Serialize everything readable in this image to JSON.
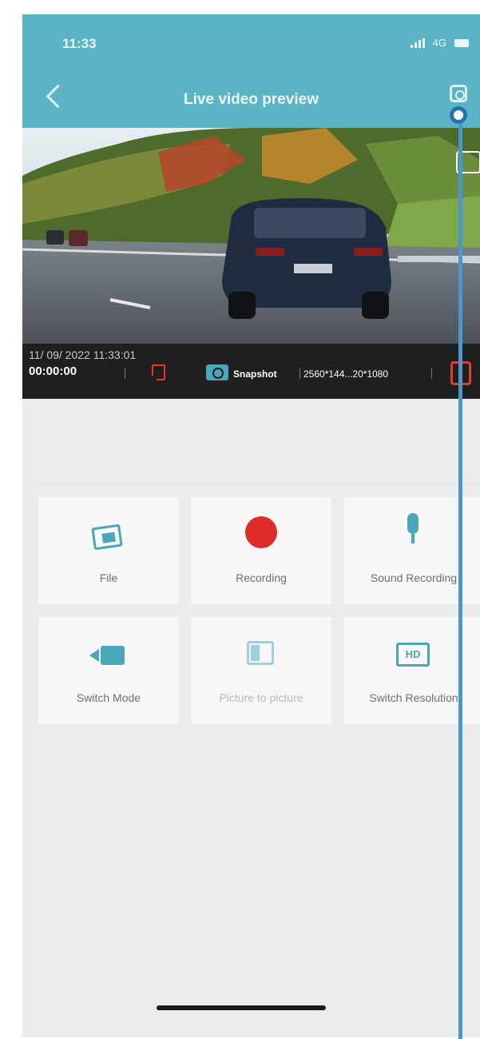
{
  "status_bar": {
    "time": "11:33",
    "network": "4G"
  },
  "header": {
    "title": "Live video preview"
  },
  "info_bar": {
    "datetime": "11/ 09/ 2022  11:33:01",
    "elapsed": "00:00:00",
    "snapshot_label": "Snapshot",
    "resolution": "2560*144...20*1080"
  },
  "tiles": [
    {
      "label": "File",
      "icon": "image-folder-icon",
      "enabled": true
    },
    {
      "label": "Recording",
      "icon": "record-icon",
      "enabled": true
    },
    {
      "label": "Sound Recording",
      "icon": "microphone-icon",
      "enabled": true
    },
    {
      "label": "Switch Mode",
      "icon": "video-camera-icon",
      "enabled": true
    },
    {
      "label": "Picture to picture",
      "icon": "picture-in-picture-icon",
      "enabled": false
    },
    {
      "label": "Switch Resolution",
      "icon": "hd-icon",
      "enabled": true
    }
  ],
  "icon_labels": {
    "hd": "HD"
  },
  "colors": {
    "header": "#5bb4c4",
    "accent": "#4aa6bb",
    "record": "#e02b2b",
    "info_bar": "#1f1f1f",
    "background": "#ececec"
  }
}
